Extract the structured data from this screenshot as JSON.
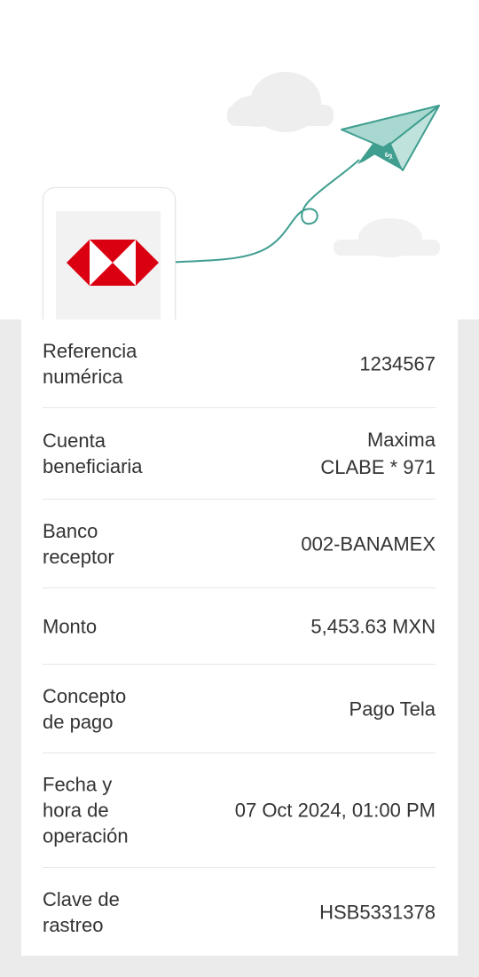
{
  "receipt": {
    "rows": [
      {
        "label": "Referencia\nnumérica",
        "value": "1234567"
      },
      {
        "label": "Cuenta\nbeneficiaria",
        "value_line1": "Maxima",
        "value_line2": "CLABE * 971"
      },
      {
        "label": "Banco\nreceptor",
        "value": "002-BANAMEX"
      },
      {
        "label": "Monto",
        "value": "5,453.63 MXN"
      },
      {
        "label": "Concepto\nde pago",
        "value": "Pago Tela"
      },
      {
        "label": "Fecha y\nhora de\noperación",
        "value": "07 Oct 2024, 01:00 PM"
      },
      {
        "label": "Clave de\nrastreo",
        "value": "HSB5331378"
      }
    ]
  },
  "illustration": {
    "plane_icon": "paper-plane-icon",
    "plane_symbol": "$",
    "brand_red": "#db0011",
    "plane_color": "#3f9e8f"
  }
}
